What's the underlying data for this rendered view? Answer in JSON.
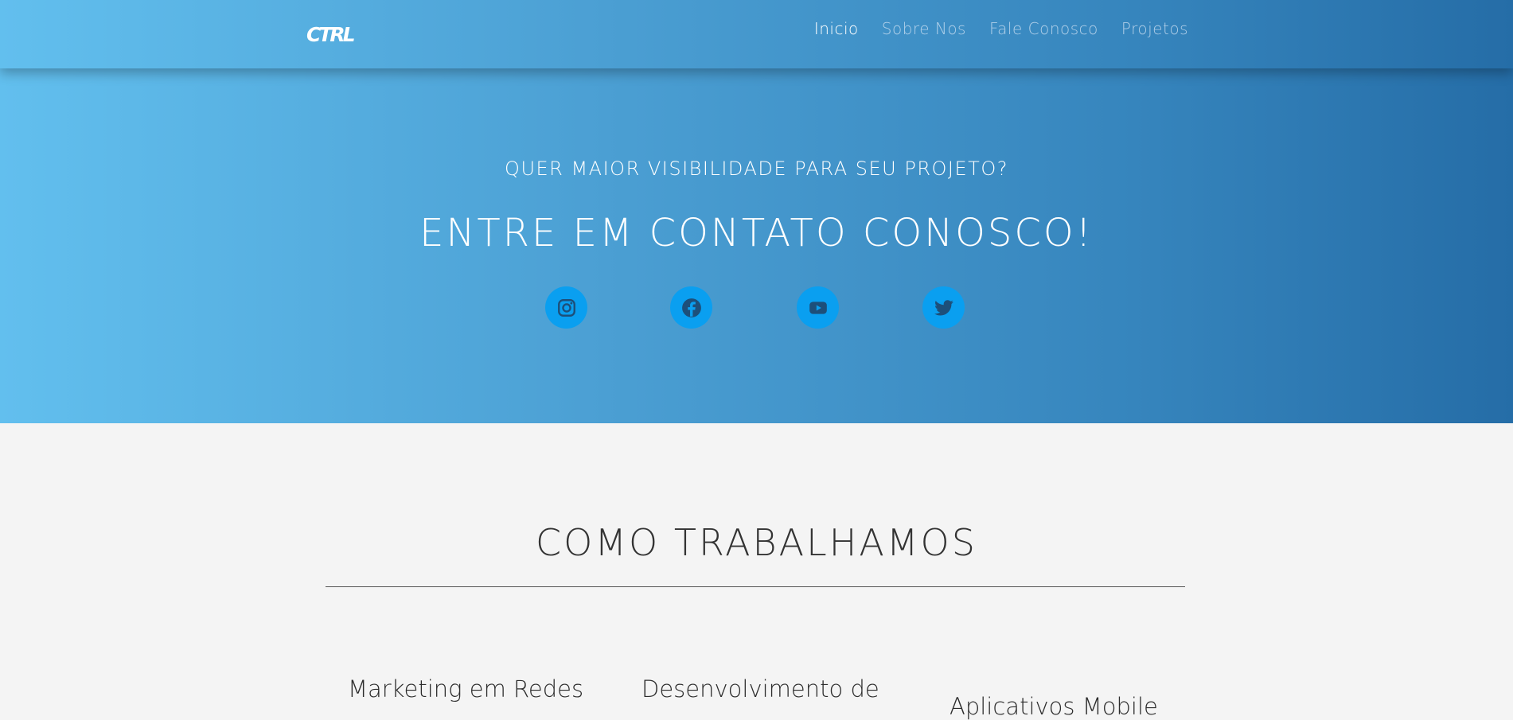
{
  "navbar": {
    "logo_text": "CTRL",
    "links": [
      {
        "label": "Inicio",
        "active": true
      },
      {
        "label": "Sobre Nos",
        "active": false
      },
      {
        "label": "Fale Conosco",
        "active": false
      },
      {
        "label": "Projetos",
        "active": false
      }
    ]
  },
  "hero": {
    "subtitle": "QUER MAIOR VISIBILIDADE PARA SEU PROJETO?",
    "title": "ENTRE EM CONTATO CONOSCO!",
    "social": [
      {
        "icon": "instagram-icon"
      },
      {
        "icon": "facebook-icon"
      },
      {
        "icon": "youtube-icon"
      },
      {
        "icon": "twitter-icon"
      }
    ]
  },
  "section": {
    "title": "COMO TRABALHAMOS",
    "cards": [
      {
        "title": "Marketing em Redes"
      },
      {
        "title": "Desenvolvimento de"
      },
      {
        "title": "Aplicativos Mobile"
      }
    ]
  },
  "colors": {
    "gradient_start": "#62bfee",
    "gradient_end": "#256da7",
    "social_bg": "#0a9ff0",
    "icon_fill": "#1d4f7a",
    "page_bg": "#f4f4f4"
  }
}
